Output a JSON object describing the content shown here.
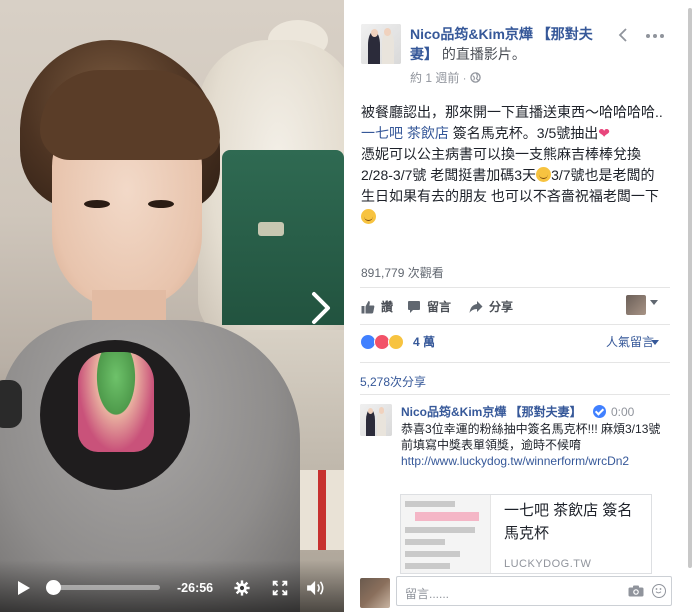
{
  "post": {
    "page_name": "Nico品筠&Kim京燁 【那對夫妻】",
    "page_suffix": "的直播影片。",
    "time_ago": "約 1 週前",
    "text_intro": "被餐廳認出，那來開一下直播送東西～哈哈哈哈..",
    "place_link": "一七吧 茶飲店",
    "text_line2": " 簽名馬克杯。3/5號抽出",
    "text_line3": "憑妮可以公主病書可以換一支熊麻吉棒棒兌換2/28-3/7號 老闆挺書加碼3天",
    "text_line4": "3/7號也是老闆的生日如果有去的朋友 也可以不吝嗇祝福老闆一下",
    "views": "891,779 次觀看"
  },
  "actions": {
    "like": "讚",
    "comment": "留言",
    "share": "分享"
  },
  "reactions": {
    "count": "4 萬",
    "sort": "人氣留言"
  },
  "shares": "5,278次分享",
  "comment": {
    "author": "Nico品筠&Kim京燁 【那對夫妻】",
    "time": "0:00",
    "text": "恭喜3位幸運的粉絲抽中簽名馬克杯!!! 麻煩3/13號前填寫中獎表單領獎，逾時不候唷",
    "link": "http://www.luckydog.tw/winnerform/wrcDn2",
    "card_title": "一七吧 茶飲店 簽名馬克杯",
    "card_domain": "LUCKYDOG.TW"
  },
  "compose": {
    "placeholder": "留言......"
  },
  "video": {
    "time_remaining": "-26:56",
    "progress": 0.03
  },
  "colors": {
    "link_blue": "#365899",
    "like_blue": "#4080ff",
    "love_red": "#f25268",
    "haha_yellow": "#f7c340"
  },
  "icons": [
    "play-icon",
    "gear-icon",
    "fullscreen-icon",
    "volume-icon",
    "chevron-right-icon",
    "chevron-left-icon",
    "more-icon",
    "globe-icon",
    "like-icon",
    "comment-icon",
    "share-icon",
    "camera-icon",
    "emoji-icon",
    "verified-icon"
  ]
}
